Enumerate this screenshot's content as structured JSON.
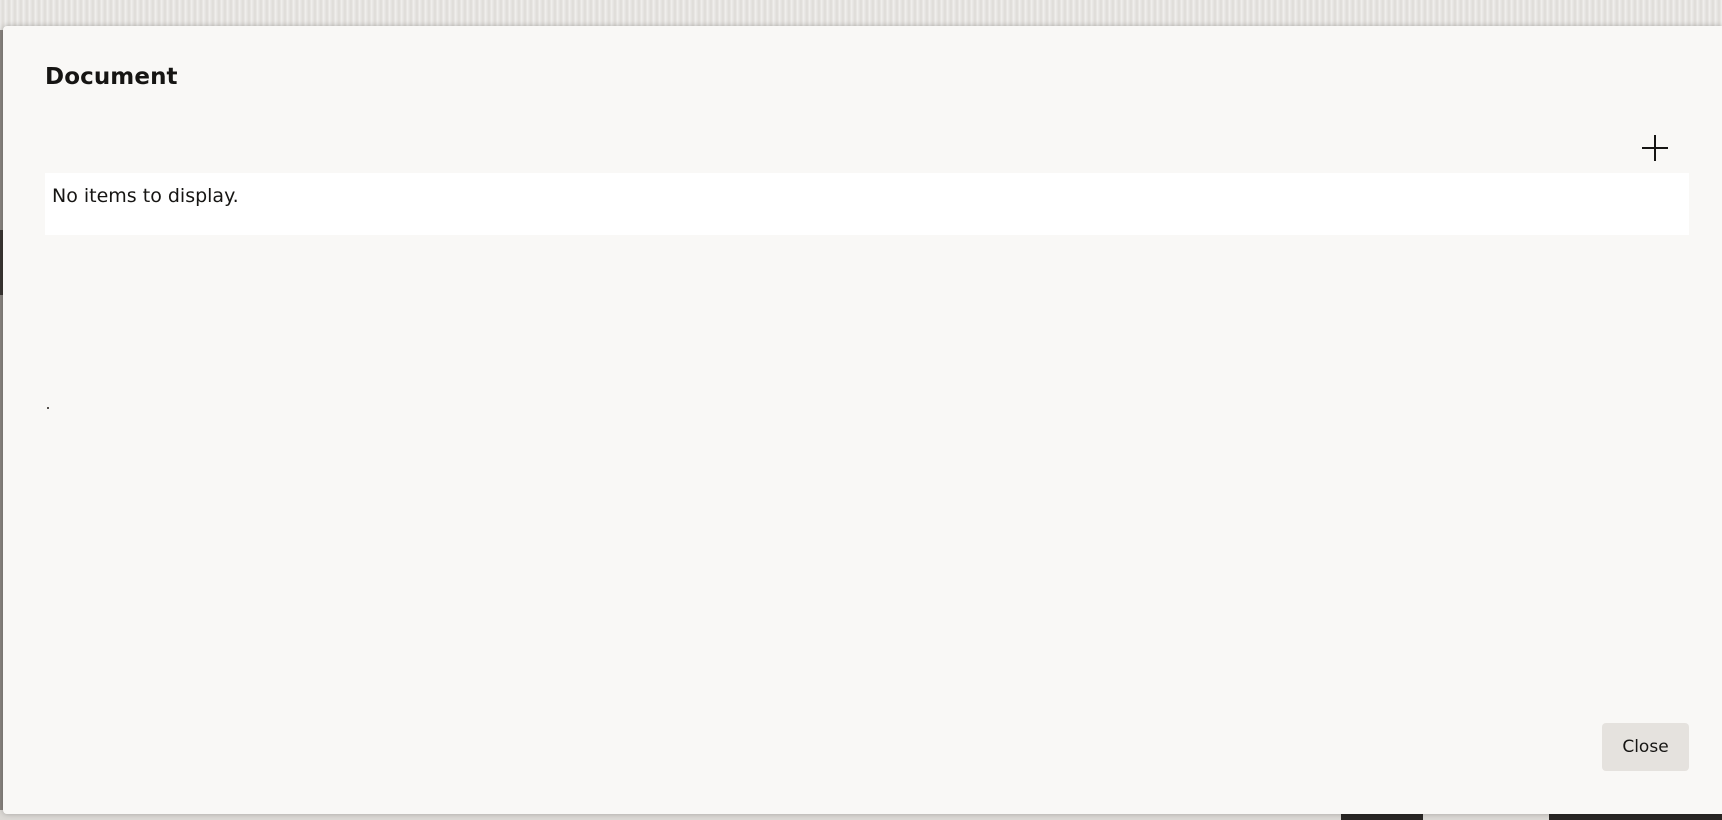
{
  "dialog": {
    "title": "Document",
    "add_icon": "plus-icon",
    "empty_message": "No items to display.",
    "close_label": "Close"
  },
  "colors": {
    "dialog_background": "#f9f8f6",
    "table_background": "#ffffff",
    "button_background": "#e5e2de",
    "text": "#161513"
  }
}
